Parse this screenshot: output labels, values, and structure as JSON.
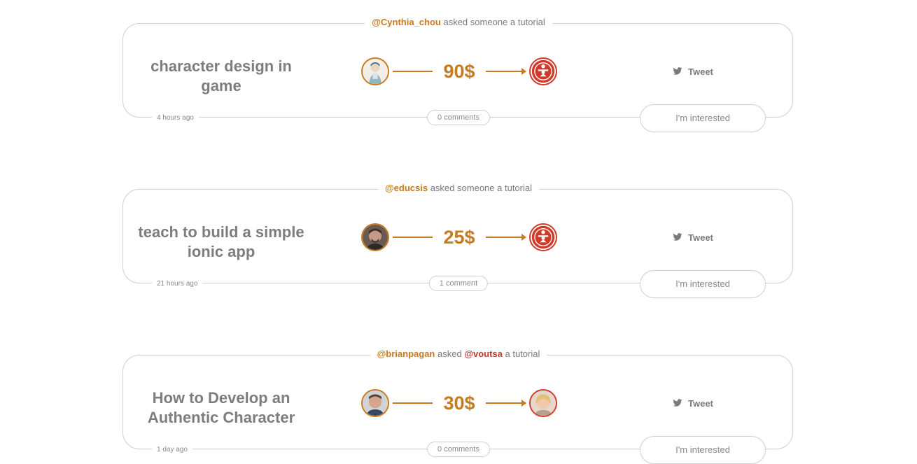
{
  "requests": [
    {
      "requester": "@Cynthia_chou",
      "verb": "asked",
      "target": "someone",
      "suffix": "a tutorial",
      "title": "character design in game",
      "price": "90$",
      "tweet_label": "Tweet",
      "time": "4 hours ago",
      "comments": "0 comments",
      "interested_label": "I'm interested",
      "from_avatar_icon": "user-avatar-illustration",
      "to_avatar_icon": "anonymous-tutor-icon"
    },
    {
      "requester": "@educsis",
      "verb": "asked",
      "target": "someone",
      "suffix": "a tutorial",
      "title": "teach to build a simple ionic app",
      "price": "25$",
      "tweet_label": "Tweet",
      "time": "21 hours ago",
      "comments": "1 comment",
      "interested_label": "I'm interested",
      "from_avatar_icon": "user-avatar-photo",
      "to_avatar_icon": "anonymous-tutor-icon"
    },
    {
      "requester": "@brianpagan",
      "verb": "asked",
      "target": "@voutsa",
      "suffix": "a tutorial",
      "title": "How to Develop an Authentic Character",
      "price": "30$",
      "tweet_label": "Tweet",
      "time": "1 day ago",
      "comments": "0 comments",
      "interested_label": "I'm interested",
      "from_avatar_icon": "user-avatar-photo",
      "to_avatar_icon": "user-avatar-photo"
    }
  ],
  "colors": {
    "accent": "#c87a1e",
    "target_red": "#d03a2a",
    "text": "#7d7d7d",
    "border": "#cfcfcf"
  }
}
